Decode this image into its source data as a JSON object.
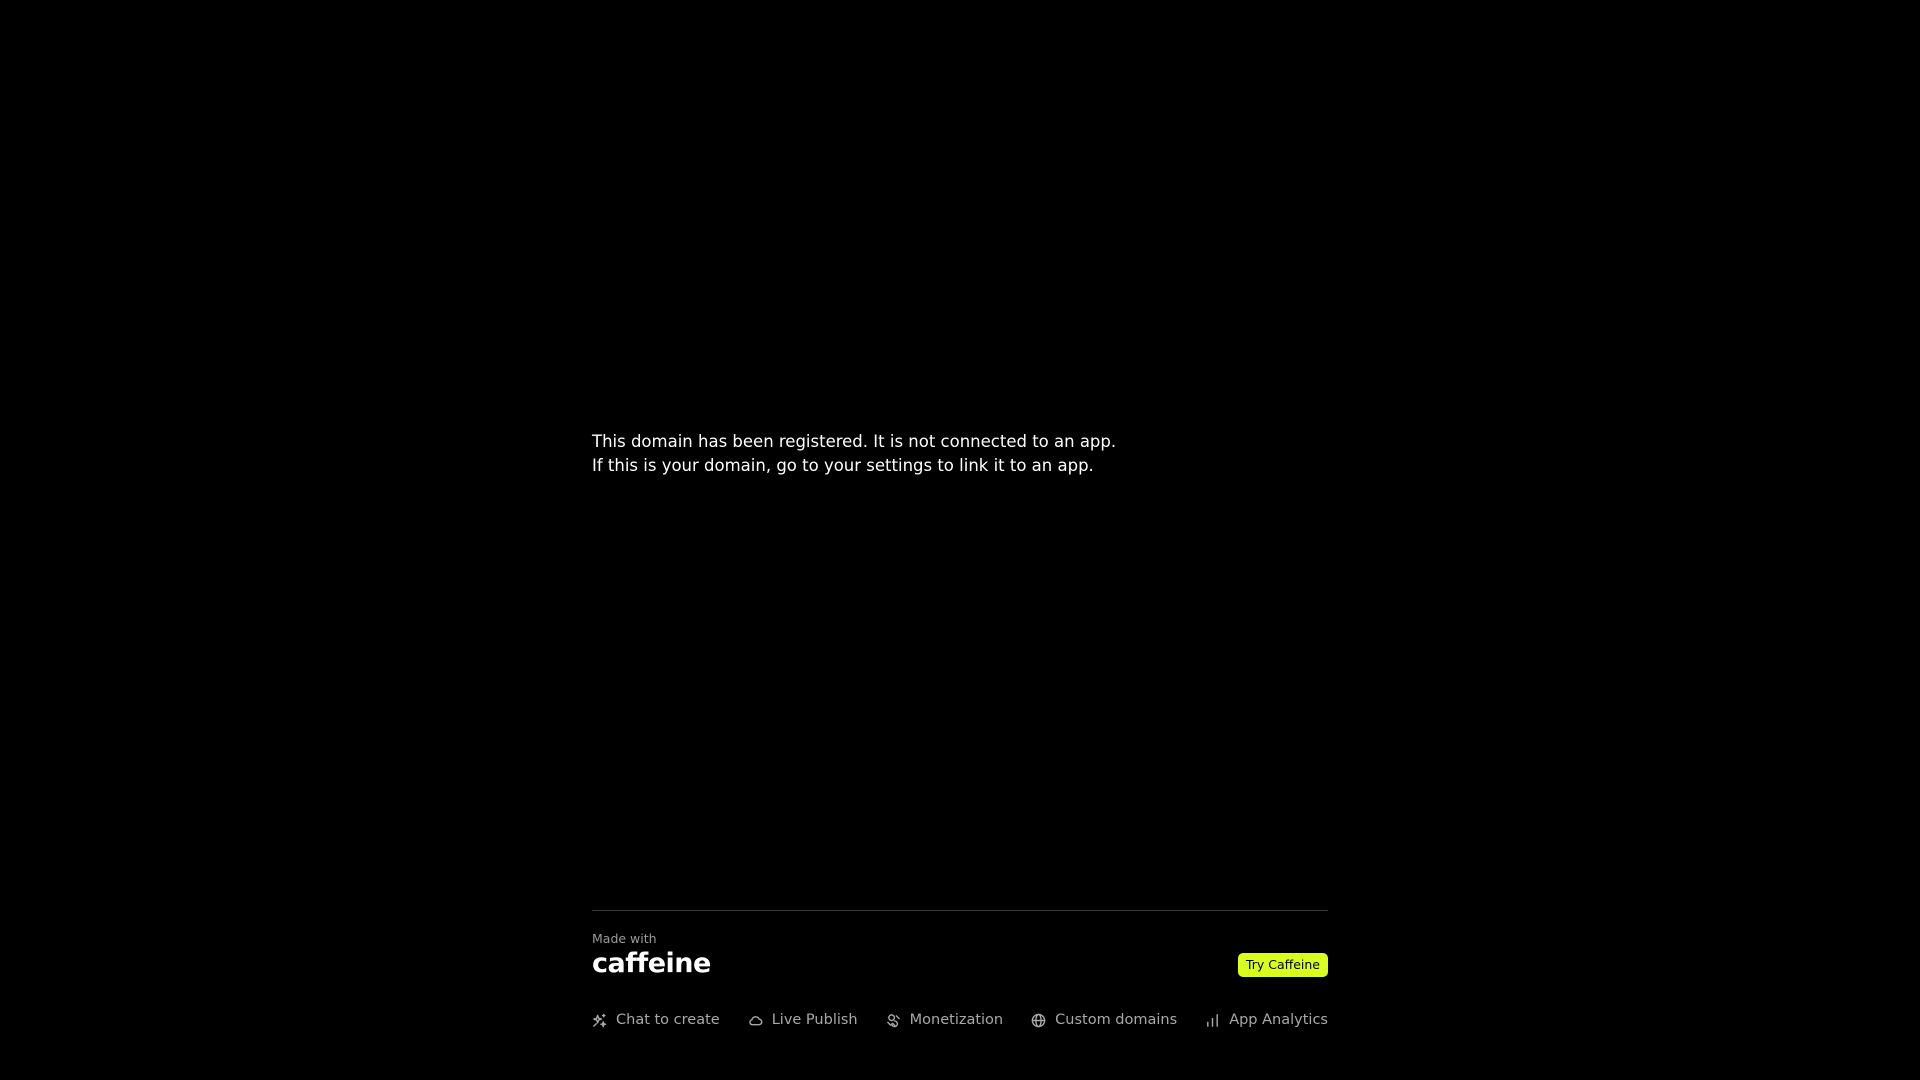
{
  "message": {
    "line1": "This domain has been registered. It is not connected to an app.",
    "line2": "If this is your domain, go to your settings to link it to an app."
  },
  "footer": {
    "made_with": "Made with",
    "logo_text": "caffeine",
    "cta_label": "Try Caffeine",
    "cta_color": "#d9ff1e",
    "features": [
      {
        "label": "Chat to create",
        "icon": "sparkles-icon"
      },
      {
        "label": "Live Publish",
        "icon": "cloud-icon"
      },
      {
        "label": "Monetization",
        "icon": "coins-icon"
      },
      {
        "label": "Custom domains",
        "icon": "globe-icon"
      },
      {
        "label": "App Analytics",
        "icon": "bar-chart-icon"
      }
    ]
  }
}
